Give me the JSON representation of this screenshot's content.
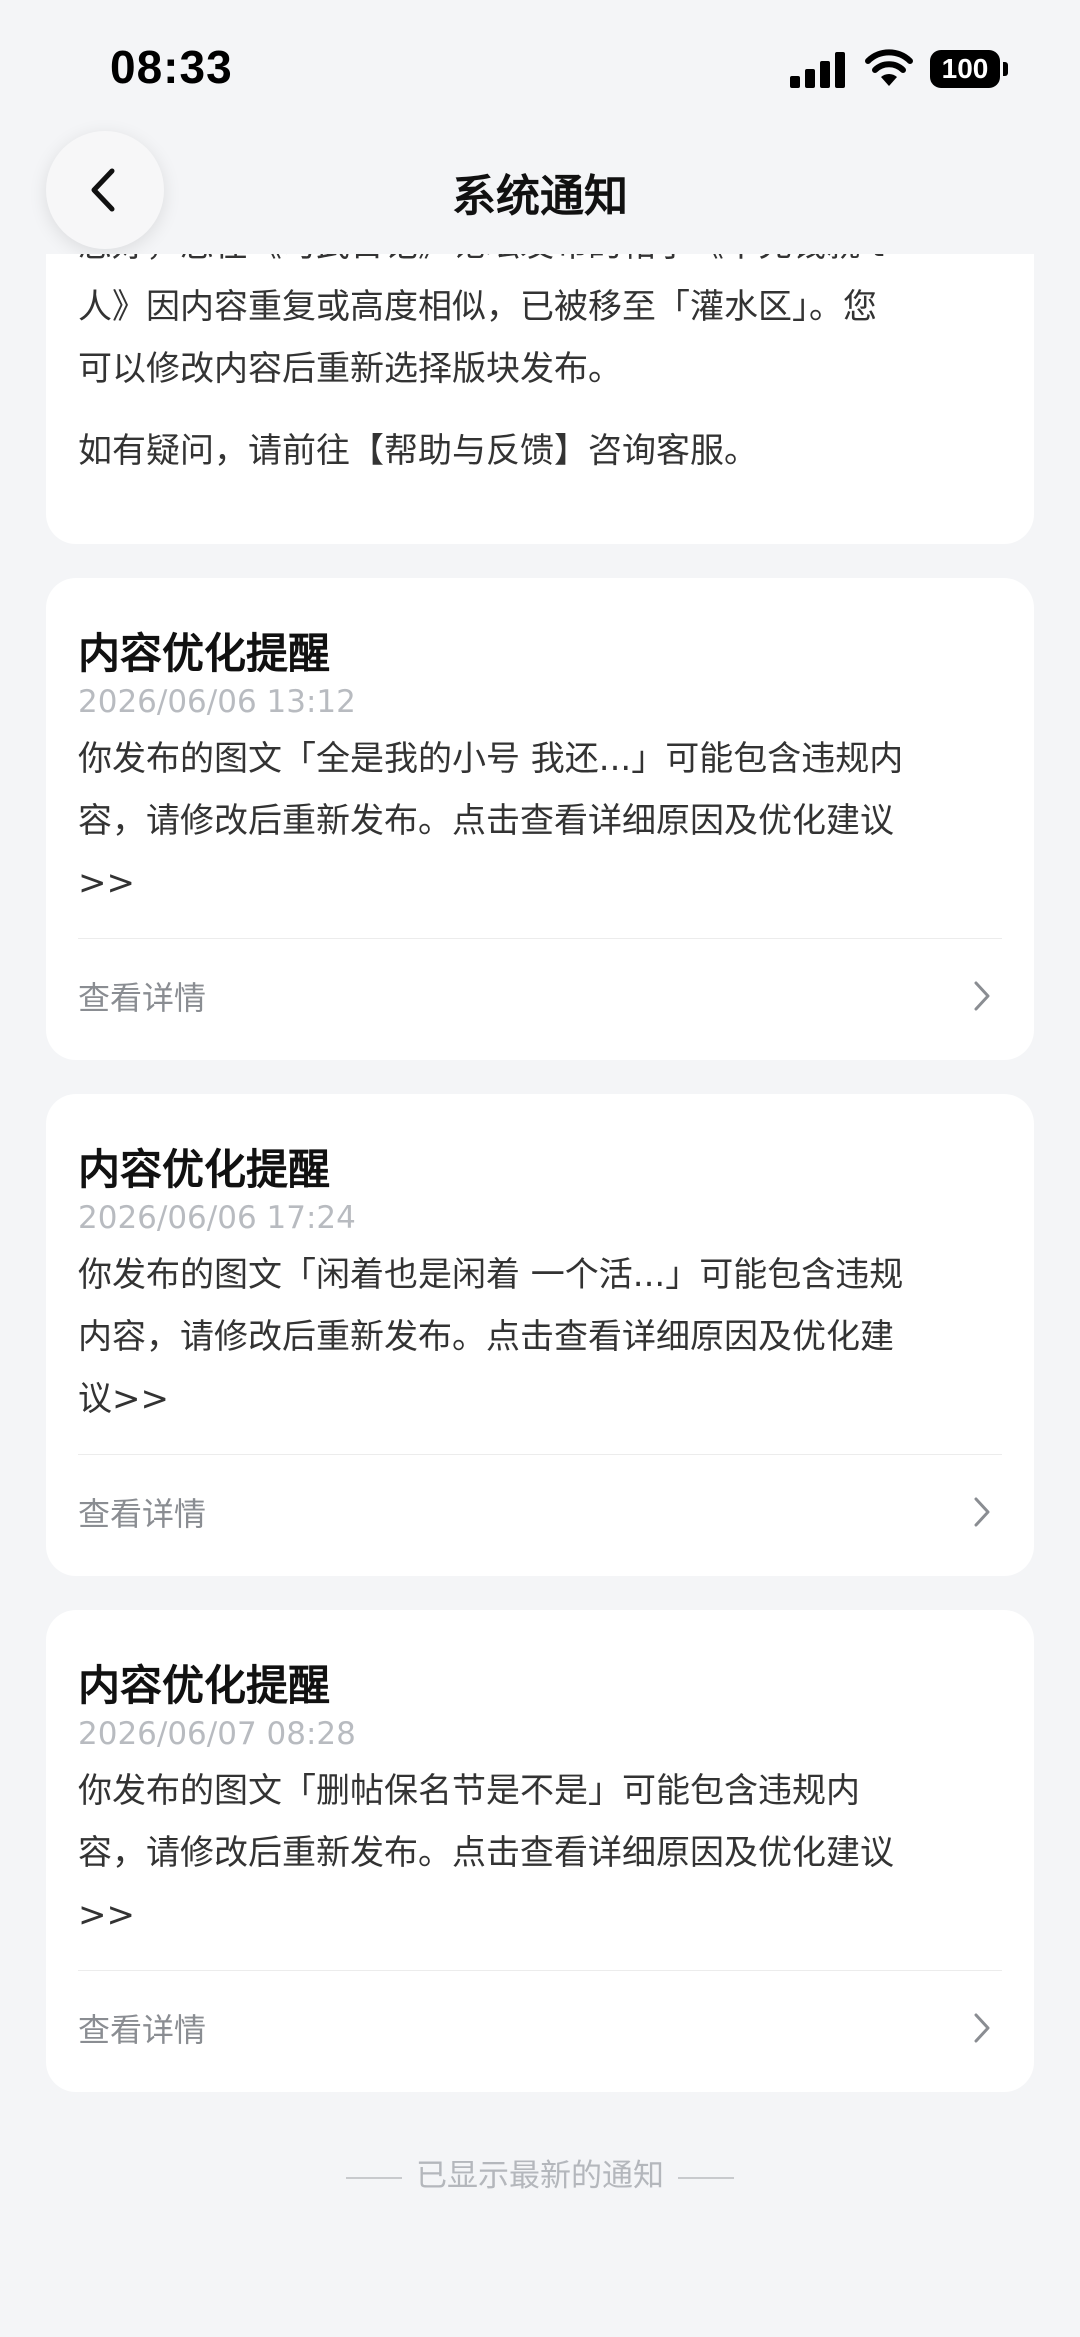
{
  "status_bar": {
    "time": "08:33",
    "battery": "100",
    "icons": [
      "signal-icon",
      "wifi-icon",
      "battery-icon"
    ]
  },
  "nav": {
    "title": "系统通知",
    "back_icon": "chevron-left-icon"
  },
  "partial_notice": {
    "lines": [
      "您好，您在《习武日记》论坛发布的帖子《不充钱就 t",
      "人》因内容重复或高度相似，已被移至「灌水区」。您",
      "可以修改内容后重新选择版块发布。"
    ],
    "help_text": "如有疑问，请前往【帮助与反馈】咨询客服。"
  },
  "notices": [
    {
      "title": "内容优化提醒",
      "time": "2026/06/06 13:12",
      "lines": [
        "你发布的图文「全是我的小号  我还...」可能包含违规内",
        "容，请修改后重新发布。点击查看详细原因及优化建议",
        ">>"
      ],
      "detail_label": "查看详情"
    },
    {
      "title": "内容优化提醒",
      "time": "2026/06/06 17:24",
      "lines": [
        "你发布的图文「闲着也是闲着 一个活...」可能包含违规",
        "内容，请修改后重新发布。点击查看详细原因及优化建",
        "议>>"
      ],
      "detail_label": "查看详情"
    },
    {
      "title": "内容优化提醒",
      "time": "2026/06/07 08:28",
      "lines": [
        "你发布的图文「删帖保名节是不是」可能包含违规内",
        "容，请修改后重新发布。点击查看详细原因及优化建议",
        ">>"
      ],
      "detail_label": "查看详情"
    }
  ],
  "footer": {
    "text": "已显示最新的通知"
  },
  "colors": {
    "background": "#f4f5f7",
    "card": "#ffffff",
    "timestamp": "#b8bbc0",
    "secondary_text": "#8a8d92"
  }
}
